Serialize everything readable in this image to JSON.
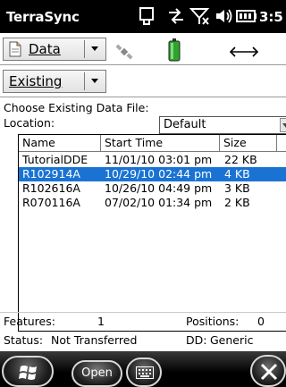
{
  "app": {
    "title": "TerraSync",
    "time": "3:5"
  },
  "toolbar": {
    "section_dropdown": "Data",
    "file_dropdown": "Existing"
  },
  "form": {
    "choose_label": "Choose Existing Data File:",
    "location_label": "Location:",
    "location_value": "Default"
  },
  "file_list": {
    "columns": [
      "Name",
      "Start Time",
      "Size"
    ],
    "rows": [
      {
        "name": "TutorialDDE",
        "start_time": "11/01/10 03:01 pm",
        "size": "22 KB",
        "selected": false
      },
      {
        "name": "R102914A",
        "start_time": "10/29/10 02:44 pm",
        "size": "4 KB",
        "selected": true
      },
      {
        "name": "R102616A",
        "start_time": "10/26/10 04:49 pm",
        "size": "3 KB",
        "selected": false
      },
      {
        "name": "R070116A",
        "start_time": "07/02/10 01:34 pm",
        "size": "2 KB",
        "selected": false
      }
    ]
  },
  "status": {
    "features_label": "Features:",
    "features_value": "1",
    "positions_label": "Positions:",
    "positions_value": "0",
    "status_label": "Status:",
    "status_value": "Not Transferred",
    "dd_label": "DD:",
    "dd_value": "Generic"
  },
  "bottom": {
    "open_label": "Open"
  },
  "colors": {
    "selection": "#1a73d3",
    "titlebar": "#000000"
  },
  "icons": [
    "windows-start-icon",
    "keyboard-icon",
    "close-icon",
    "gps-satellite-icon",
    "battery-icon",
    "width-arrows-icon"
  ]
}
